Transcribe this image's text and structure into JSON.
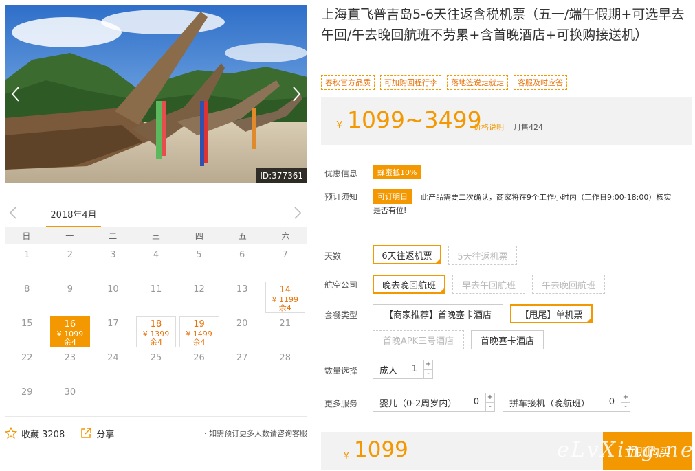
{
  "hero": {
    "image_id": "ID:377361",
    "prev_icon": "chevron-left-icon",
    "next_icon": "chevron-right-icon"
  },
  "calendar": {
    "month": "2018年4月",
    "weekdays": [
      "日",
      "一",
      "二",
      "三",
      "四",
      "五",
      "六"
    ],
    "days": [
      {
        "d": "1"
      },
      {
        "d": "2"
      },
      {
        "d": "3"
      },
      {
        "d": "4"
      },
      {
        "d": "5"
      },
      {
        "d": "6"
      },
      {
        "d": "7"
      },
      {
        "d": "8"
      },
      {
        "d": "9"
      },
      {
        "d": "10"
      },
      {
        "d": "11"
      },
      {
        "d": "12"
      },
      {
        "d": "13"
      },
      {
        "d": "14",
        "price": "¥ 1199",
        "remain": "余4"
      },
      {
        "d": "15"
      },
      {
        "d": "16",
        "price": "¥ 1099",
        "remain": "余4",
        "selected": true
      },
      {
        "d": "17"
      },
      {
        "d": "18",
        "price": "¥ 1399",
        "remain": "余4"
      },
      {
        "d": "19",
        "price": "¥ 1499",
        "remain": "余4"
      },
      {
        "d": "20"
      },
      {
        "d": "21"
      },
      {
        "d": "22"
      },
      {
        "d": "23"
      },
      {
        "d": "24"
      },
      {
        "d": "25"
      },
      {
        "d": "26"
      },
      {
        "d": "27"
      },
      {
        "d": "28"
      },
      {
        "d": "29"
      },
      {
        "d": "30"
      }
    ]
  },
  "footer": {
    "favorite_label": "收藏 3208",
    "share_label": "分享",
    "note": "· 如需预订更多人数请咨询客服"
  },
  "product": {
    "title": "上海直飞普吉岛5-6天往返含税机票（五一/端午假期+可选早去午回/午去晚回航班不劳累+含首晚酒店+可换购接送机）",
    "tags": [
      "春秋官方品质",
      "可加购回程行李",
      "落地签说走就走",
      "客服及时应答"
    ]
  },
  "price": {
    "currency": "¥",
    "range": "1099~3499",
    "explain": "价格说明",
    "monthly_sales": "月售424"
  },
  "info": {
    "discount_label": "优惠信息",
    "discount_badge": "蜂蜜抵10%",
    "notice_label": "预订须知",
    "notice_badge": "可订明日",
    "notice_text": "此产品需要二次确认，商家将在9个工作小时内（工作日9:00-18:00）核实",
    "notice_text2": "是否有位!"
  },
  "options": {
    "days_label": "天数",
    "days": [
      {
        "label": "6天往返机票",
        "state": "sel"
      },
      {
        "label": "5天往返机票",
        "state": "dis"
      }
    ],
    "airline_label": "航空公司",
    "airlines": [
      {
        "label": "晚去晚回航班",
        "state": "sel"
      },
      {
        "label": "早去午回航班",
        "state": "dis"
      },
      {
        "label": "午去晚回航班",
        "state": "dis"
      }
    ],
    "package_label": "套餐类型",
    "packages": [
      {
        "label": "【商家推荐】首晚塞卡酒店",
        "state": "norm"
      },
      {
        "label": "【甩尾】单机票",
        "state": "sel"
      },
      {
        "label": "首晚APK三号酒店",
        "state": "dis"
      },
      {
        "label": "首晚塞卡酒店",
        "state": "norm"
      }
    ],
    "quantity_label": "数量选择",
    "adult_label": "成人",
    "adult_value": "1",
    "more_label": "更多服务",
    "infant_label": "婴儿（0-2周岁内）",
    "infant_value": "0",
    "transfer_label": "拼车接机（晚航班）",
    "transfer_value": "0",
    "plus": "+",
    "minus": "-"
  },
  "bottom": {
    "currency": "¥",
    "price": "1099",
    "buy_label": "立即购买",
    "watermark": "eLvXing.net"
  },
  "colors": {
    "accent": "#f39800",
    "accent_text": "#e8730c"
  }
}
